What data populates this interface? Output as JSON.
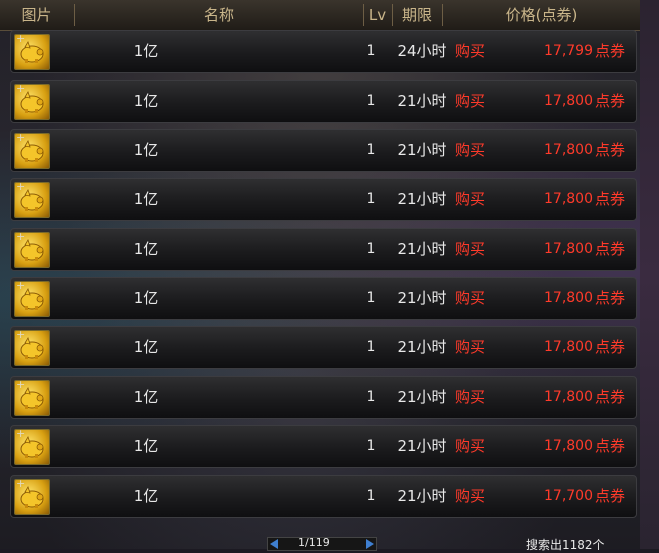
{
  "header": {
    "col_image": "图片",
    "col_name": "名称",
    "col_lv": "Lv",
    "col_period": "期限",
    "col_price": "价格(点券)"
  },
  "items": [
    {
      "name": "1亿",
      "lv": "1",
      "period": "24小时",
      "buy": "购买",
      "price": "17,799",
      "unit": "点券"
    },
    {
      "name": "1亿",
      "lv": "1",
      "period": "21小时",
      "buy": "购买",
      "price": "17,800",
      "unit": "点券"
    },
    {
      "name": "1亿",
      "lv": "1",
      "period": "21小时",
      "buy": "购买",
      "price": "17,800",
      "unit": "点券"
    },
    {
      "name": "1亿",
      "lv": "1",
      "period": "21小时",
      "buy": "购买",
      "price": "17,800",
      "unit": "点券"
    },
    {
      "name": "1亿",
      "lv": "1",
      "period": "21小时",
      "buy": "购买",
      "price": "17,800",
      "unit": "点券"
    },
    {
      "name": "1亿",
      "lv": "1",
      "period": "21小时",
      "buy": "购买",
      "price": "17,800",
      "unit": "点券"
    },
    {
      "name": "1亿",
      "lv": "1",
      "period": "21小时",
      "buy": "购买",
      "price": "17,800",
      "unit": "点券"
    },
    {
      "name": "1亿",
      "lv": "1",
      "period": "21小时",
      "buy": "购买",
      "price": "17,800",
      "unit": "点券"
    },
    {
      "name": "1亿",
      "lv": "1",
      "period": "21小时",
      "buy": "购买",
      "price": "17,800",
      "unit": "点券"
    },
    {
      "name": "1亿",
      "lv": "1",
      "period": "21小时",
      "buy": "购买",
      "price": "17,700",
      "unit": "点券"
    }
  ],
  "pagination": {
    "page": "1/119"
  },
  "footer": {
    "count": "搜索出1182个"
  },
  "colors": {
    "price": "#ff3a2a",
    "header_text": "#c9b58a",
    "item_text": "#e8e8e8"
  },
  "icons": {
    "item": "gold-pig-icon"
  }
}
